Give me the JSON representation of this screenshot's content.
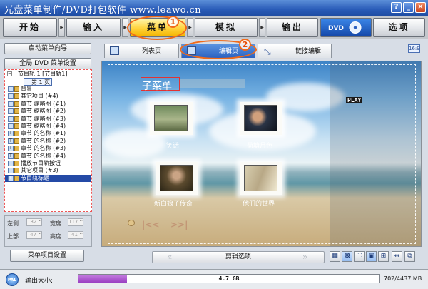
{
  "window": {
    "title": "光盘菜单制作/DVD打包软件 www.leawo.cn",
    "buttons": {
      "help": "?",
      "minimize": "_",
      "close": "×"
    }
  },
  "main_tabs": [
    {
      "label": "开始"
    },
    {
      "label": "输入"
    },
    {
      "label": "菜单",
      "active": true
    },
    {
      "label": "模拟"
    },
    {
      "label": "输出"
    },
    {
      "label": "DVD"
    },
    {
      "label": "选项"
    }
  ],
  "annotations": {
    "one": "1",
    "two": "2"
  },
  "left_panel": {
    "wizard_button": "启动菜单向导",
    "dvd_settings_button": "全局 DVD 菜单设置",
    "tree": {
      "root": "节目轨 1 [节目轨1]",
      "page": "第 1 页",
      "items": [
        {
          "label": "背景",
          "icon": "image-icon"
        },
        {
          "label": "其它项目 (#4)",
          "icon": "image-icon"
        },
        {
          "label": "章节 缩略图 (#1)",
          "icon": "image-icon"
        },
        {
          "label": "章节 缩略图 (#2)",
          "icon": "image-icon"
        },
        {
          "label": "章节 缩略图 (#3)",
          "icon": "image-icon"
        },
        {
          "label": "章节 缩略图 (#4)",
          "icon": "image-icon"
        },
        {
          "label": "章节 的名称 (#1)",
          "icon": "text-icon"
        },
        {
          "label": "章节 的名称 (#2)",
          "icon": "text-icon"
        },
        {
          "label": "章节 的名称 (#3)",
          "icon": "text-icon"
        },
        {
          "label": "章节 的名称 (#4)",
          "icon": "text-icon"
        },
        {
          "label": "播放节目轨按钮",
          "icon": "image-icon"
        },
        {
          "label": "其它项目 (#3)",
          "icon": "image-icon"
        },
        {
          "label": "节目轨标题",
          "icon": "text-icon",
          "selected": true
        }
      ]
    },
    "position": {
      "left_label": "左侧",
      "left_value": "132",
      "width_label": "宽度",
      "width_value": "117",
      "top_label": "上部",
      "top_value": "47",
      "height_label": "高度",
      "height_value": "41"
    },
    "item_settings_button": "菜单项目设置"
  },
  "sub_tabs": [
    {
      "label": "列表页"
    },
    {
      "label": "编辑页",
      "active": true
    },
    {
      "label": "链接编辑"
    }
  ],
  "aspect_badge": "16:9",
  "canvas": {
    "menu_title": "子菜单",
    "play_button": "PLAY",
    "thumbnails": [
      {
        "label": "笑话"
      },
      {
        "label": "荷塘月色"
      },
      {
        "label": "新白娘子传奇"
      },
      {
        "label": "他们的世界"
      }
    ]
  },
  "bottom_nav": {
    "prev": "«",
    "label": "剪辑选项",
    "next": "»"
  },
  "status": {
    "tv_standard": "PAL",
    "output_size_label": "输出大小:",
    "disc_capacity": "4.7 GB",
    "used_fraction": 0.16,
    "size_readout": "702/4437 MB"
  }
}
